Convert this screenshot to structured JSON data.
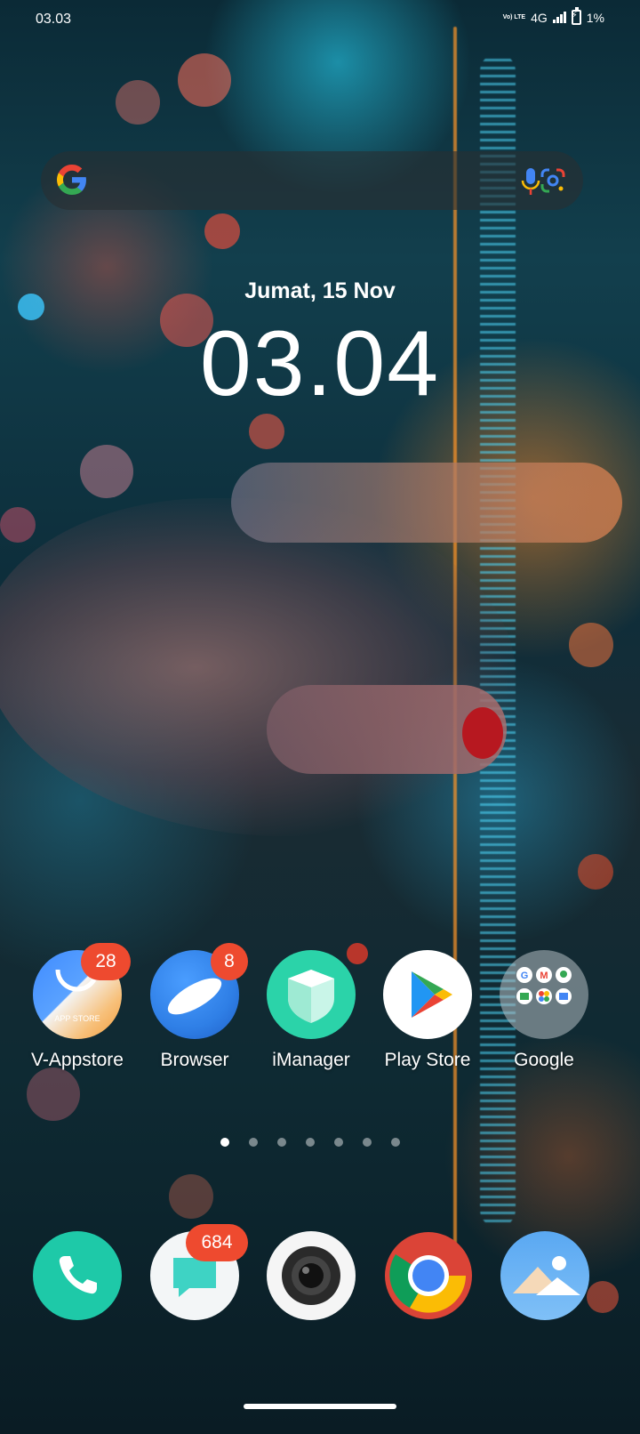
{
  "status_bar": {
    "time": "03.03",
    "volte_label": "Vo) LTE",
    "network_label": "4G",
    "battery_level": "1%"
  },
  "search_widget": {
    "logo": "google-g-icon",
    "mic": "mic-icon",
    "lens": "lens-icon"
  },
  "clock": {
    "date": "Jumat, 15 Nov",
    "time": "03.04"
  },
  "apps": [
    {
      "label": "V-Appstore",
      "badge": "28",
      "icon": "vappstore-icon",
      "icon_text": "APP STORE"
    },
    {
      "label": "Browser",
      "badge": "8",
      "icon": "browser-icon"
    },
    {
      "label": "iManager",
      "icon": "imanager-icon"
    },
    {
      "label": "Play Store",
      "icon": "play-store-icon"
    },
    {
      "label": "Google",
      "icon": "google-folder-icon"
    }
  ],
  "page_indicator": {
    "count": 7,
    "active_index": 0
  },
  "dock": [
    {
      "name": "phone",
      "icon": "phone-icon"
    },
    {
      "name": "messages",
      "icon": "messages-icon",
      "badge": "684"
    },
    {
      "name": "camera",
      "icon": "camera-icon"
    },
    {
      "name": "chrome",
      "icon": "chrome-icon"
    },
    {
      "name": "gallery",
      "icon": "gallery-icon"
    }
  ],
  "colors": {
    "badge": "#ee4a2f",
    "imanager": "#2bd3a9",
    "phone": "#1ec9a8",
    "browser": "#2f7fe6"
  }
}
